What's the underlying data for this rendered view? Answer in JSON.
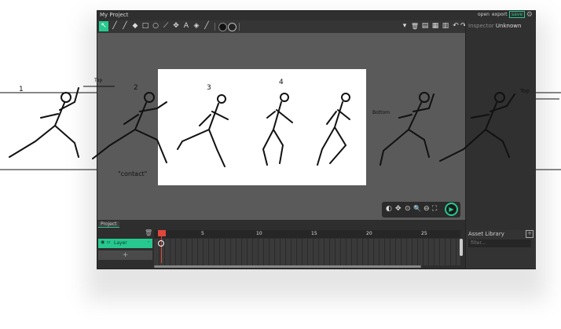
{
  "app": {
    "title": "My Project",
    "actions": {
      "open": "open",
      "export": "export",
      "save": "save"
    }
  },
  "toolbar": {
    "tools": [
      "select",
      "brush",
      "pencil",
      "eraser",
      "rectangle",
      "ellipse",
      "line",
      "fill",
      "text",
      "paint-bucket",
      "eyedropper"
    ],
    "icons": [
      "↖",
      "╱",
      "╱",
      "◆",
      "□",
      "○",
      "⟋",
      "✥",
      "A",
      "◈",
      "╱"
    ],
    "stroke_color": "#111111",
    "fill_color": "#222222",
    "right_icons": [
      "▾",
      "🗑",
      "▤",
      "▦",
      "▥",
      "↶",
      "↷"
    ]
  },
  "inspector": {
    "label": "Inspector",
    "value": "Unknown"
  },
  "timeline": {
    "tab": "Project",
    "layer_name": "Layer",
    "frame_labels": [
      "5",
      "10",
      "15",
      "20",
      "25"
    ],
    "add_label": "+"
  },
  "navigator": {
    "icons": [
      "◐",
      "✥",
      "⊙",
      "🔍",
      "⊖",
      "⛶"
    ],
    "play": "▶"
  },
  "asset_library": {
    "title": "Asset Library",
    "search_placeholder": "filter..."
  },
  "annotations": [
    "1",
    "2",
    "3",
    "4",
    "Top",
    "Bottom",
    "\"contact\"",
    "Top"
  ],
  "colors": {
    "accent": "#27c88f",
    "playhead": "#e0463b"
  }
}
